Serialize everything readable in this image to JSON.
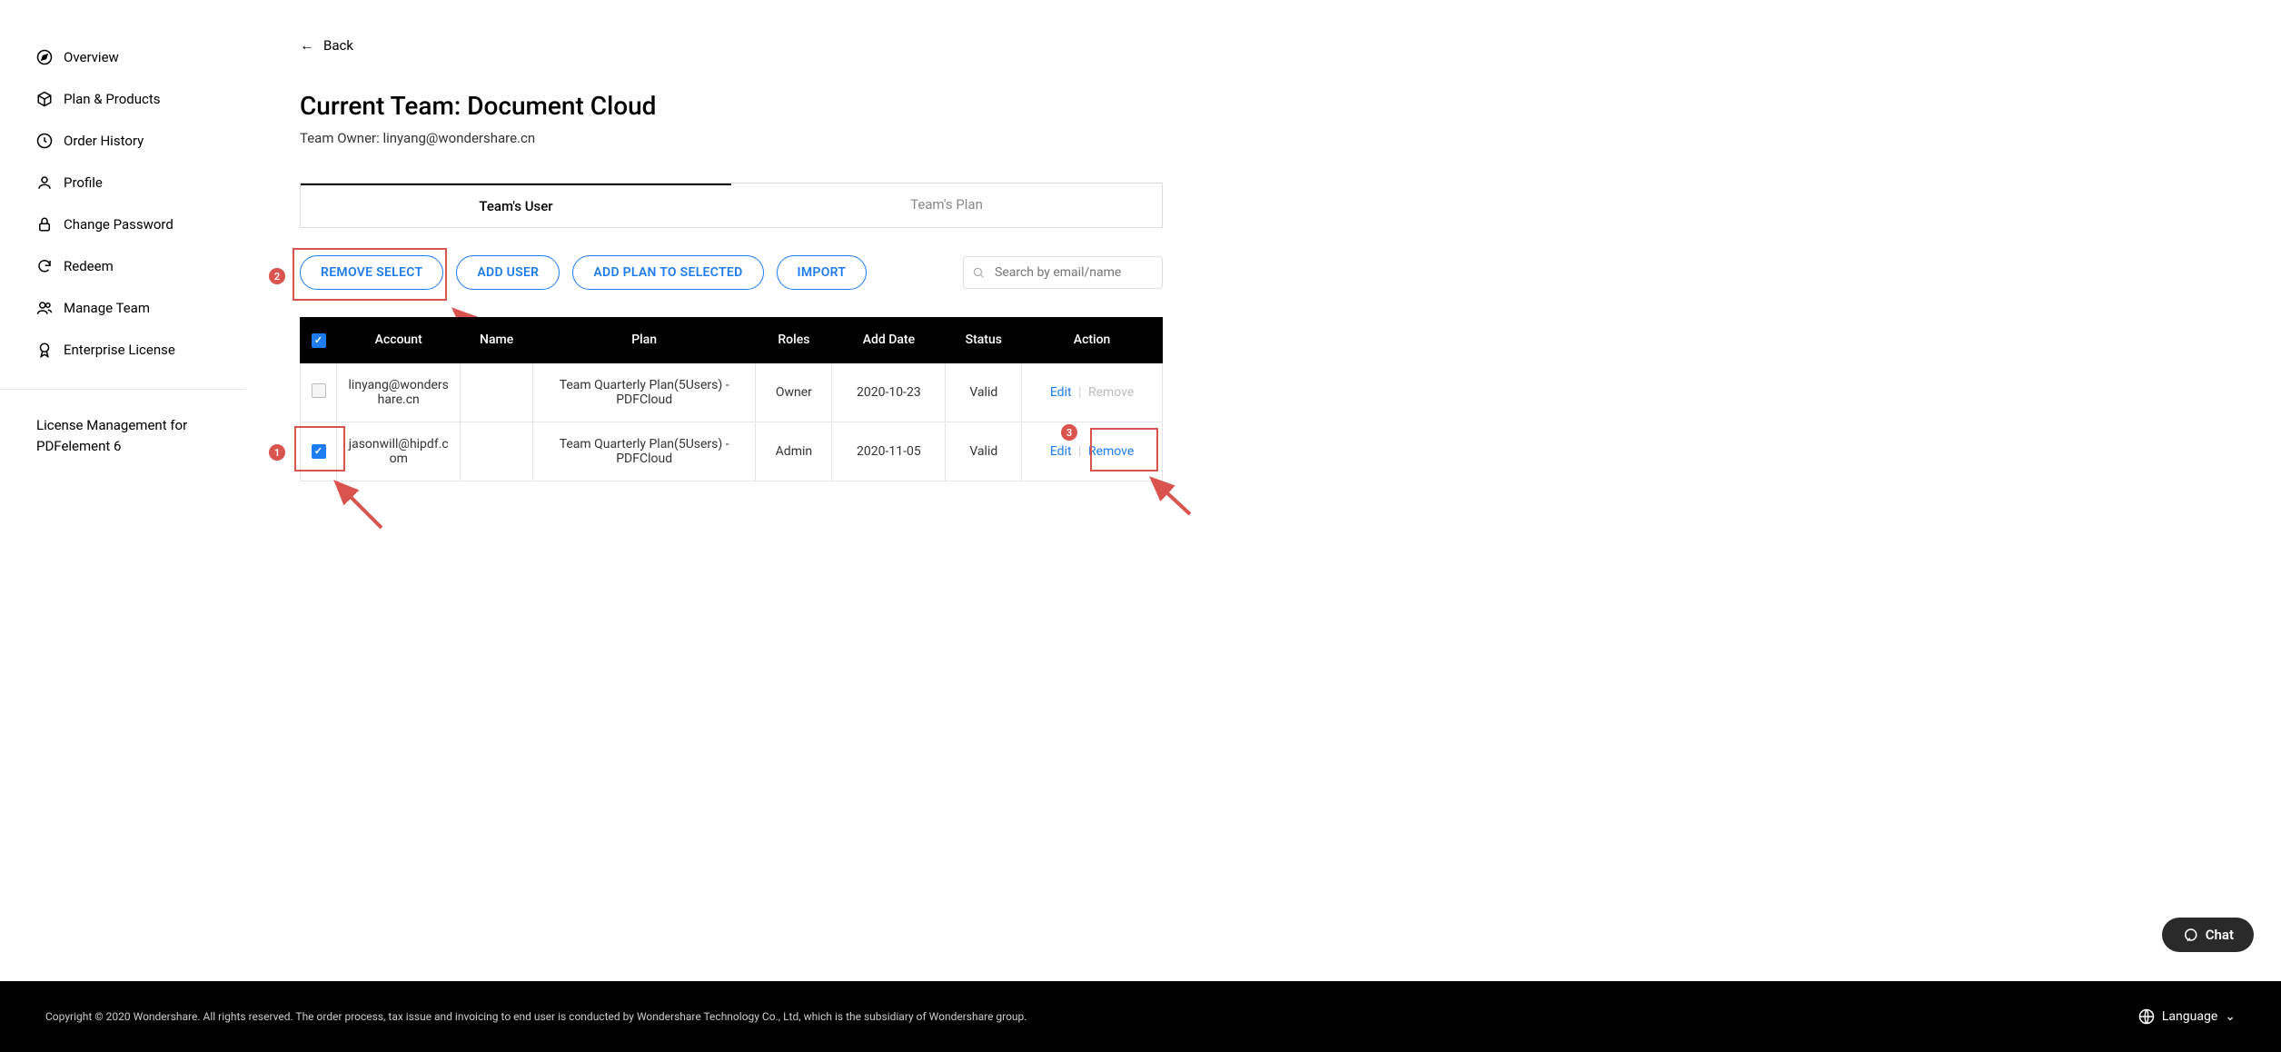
{
  "sidebar": {
    "items": [
      {
        "label": "Overview"
      },
      {
        "label": "Plan & Products"
      },
      {
        "label": "Order History"
      },
      {
        "label": "Profile"
      },
      {
        "label": "Change Password"
      },
      {
        "label": "Redeem"
      },
      {
        "label": "Manage Team"
      },
      {
        "label": "Enterprise License"
      }
    ],
    "footer_text": "License Management for PDFelement 6"
  },
  "main": {
    "back_label": "Back",
    "title": "Current Team: Document Cloud",
    "team_owner_label": "Team Owner: linyang@wondershare.cn",
    "tabs": [
      {
        "label": "Team's User"
      },
      {
        "label": "Team's Plan"
      }
    ],
    "buttons": {
      "remove_select": "REMOVE SELECT",
      "add_user": "ADD USER",
      "add_plan": "ADD PLAN TO SELECTED",
      "import": "IMPORT"
    },
    "search_placeholder": "Search by email/name",
    "table": {
      "headers": [
        "",
        "Account",
        "Name",
        "Plan",
        "Roles",
        "Add Date",
        "Status",
        "Action"
      ],
      "rows": [
        {
          "checked": false,
          "checkbox_disabled": true,
          "account": "linyang@wondershare.cn",
          "name": "",
          "plan": "Team Quarterly Plan(5Users) - PDFCloud",
          "roles": "Owner",
          "add_date": "2020-10-23",
          "status": "Valid",
          "edit": "Edit",
          "remove": "Remove",
          "remove_disabled": true
        },
        {
          "checked": true,
          "checkbox_disabled": false,
          "account": "jasonwill@hipdf.com",
          "name": "",
          "plan": "Team Quarterly Plan(5Users) - PDFCloud",
          "roles": "Admin",
          "add_date": "2020-11-05",
          "status": "Valid",
          "edit": "Edit",
          "remove": "Remove",
          "remove_disabled": false
        }
      ]
    }
  },
  "annotations": {
    "badge1": "1",
    "badge2": "2",
    "badge3": "3"
  },
  "footer": {
    "copyright": "Copyright © 2020 Wondershare. All rights reserved. The order process, tax issue and invoicing to end user is conducted by Wondershare Technology Co., Ltd, which is the subsidiary of Wondershare group.",
    "language_label": "Language"
  },
  "chat": {
    "label": "Chat"
  }
}
